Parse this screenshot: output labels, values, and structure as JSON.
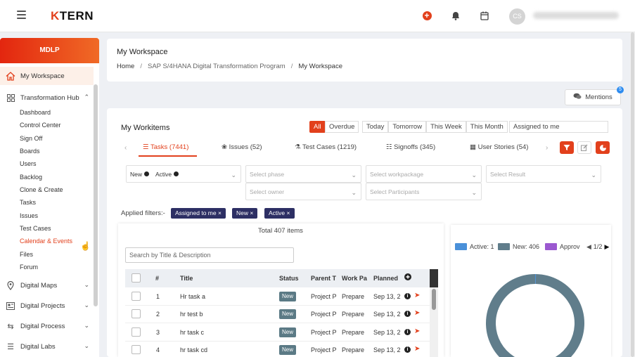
{
  "app": {
    "logo_k": "K",
    "logo_rest": "TERN",
    "avatar_initials": "CS"
  },
  "sidebar": {
    "header": "MDLP",
    "items": [
      {
        "label": "My Workspace"
      },
      {
        "label": "Transformation Hub"
      },
      {
        "label": "Digital Maps"
      },
      {
        "label": "Digital Projects"
      },
      {
        "label": "Digital Process"
      },
      {
        "label": "Digital Labs"
      }
    ],
    "subitems": [
      "Dashboard",
      "Control Center",
      "Sign Off",
      "Boards",
      "Users",
      "Backlog",
      "Clone & Create",
      "Tasks",
      "Issues",
      "Test Cases",
      "Calendar & Events",
      "Files",
      "Forum"
    ]
  },
  "header": {
    "title": "My Workspace",
    "breadcrumb": [
      "Home",
      "SAP S/4HANA Digital Transformation Program",
      "My Workspace"
    ]
  },
  "mentions": {
    "label": "Mentions",
    "count": "5"
  },
  "workitems": {
    "title": "My Workitems",
    "filters": [
      "All",
      "Overdue",
      "Today",
      "Tomorrow",
      "This Week",
      "This Month"
    ],
    "assigned_select": "Assigned to me",
    "tabs": [
      {
        "label": "Tasks (7441)"
      },
      {
        "label": "Issues (52)"
      },
      {
        "label": "Test Cases (1219)"
      },
      {
        "label": "Signoffs (345)"
      },
      {
        "label": "User Stories (54)"
      }
    ],
    "status_chips": [
      "New",
      "Active"
    ],
    "selects": {
      "phase": "Select phase",
      "workpackage": "Select workpackage",
      "result": "Select Result",
      "owner": "Select owner",
      "participants": "Select Participants"
    },
    "applied_label": "Applied filters:-",
    "applied": [
      "Assigned to me",
      "New",
      "Active"
    ],
    "total": "Total 407 items",
    "search_placeholder": "Search by Title & Description",
    "columns": [
      "#",
      "Title",
      "Status",
      "Parent T",
      "Work Pa",
      "Planned"
    ],
    "rows": [
      {
        "num": "1",
        "title": "Hr task a",
        "status": "New",
        "parent": "Project P",
        "work": "Prepare",
        "planned": "Sep 13, 2"
      },
      {
        "num": "2",
        "title": "hr test b",
        "status": "New",
        "parent": "Project P",
        "work": "Prepare",
        "planned": "Sep 13, 2"
      },
      {
        "num": "3",
        "title": "hr task c",
        "status": "New",
        "parent": "Project P",
        "work": "Prepare",
        "planned": "Sep 13, 2"
      },
      {
        "num": "4",
        "title": "hr task cd",
        "status": "New",
        "parent": "Project P",
        "work": "Prepare",
        "planned": "Sep 13, 2"
      }
    ]
  },
  "chart": {
    "legend": [
      {
        "label": "Active: 1",
        "color": "#4a90d9"
      },
      {
        "label": "New: 406",
        "color": "#607d8b"
      },
      {
        "label": "Approv",
        "color": "#9b59d0"
      }
    ],
    "pager": "1/2"
  },
  "chart_data": {
    "type": "pie",
    "categories": [
      "Active",
      "New"
    ],
    "values": [
      1,
      406
    ]
  }
}
